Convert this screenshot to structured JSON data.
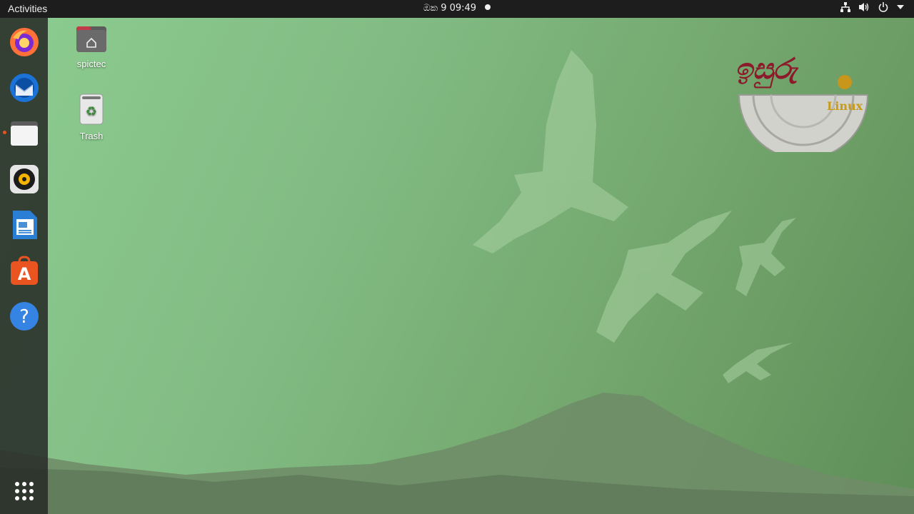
{
  "topbar": {
    "activities_label": "Activities",
    "clock_text": "ඔක 9  09:49",
    "tray_icons": [
      "network-icon",
      "volume-icon",
      "power-icon",
      "chevron-down-icon"
    ]
  },
  "dock": {
    "items": [
      {
        "name": "firefox",
        "icon": "firefox-icon",
        "running": false
      },
      {
        "name": "thunderbird",
        "icon": "thunderbird-icon",
        "running": false
      },
      {
        "name": "files",
        "icon": "files-icon",
        "running": true
      },
      {
        "name": "rhythmbox",
        "icon": "rhythmbox-icon",
        "running": false
      },
      {
        "name": "libreoffice-writer",
        "icon": "writer-icon",
        "running": false
      },
      {
        "name": "ubuntu-software",
        "icon": "software-icon",
        "running": false
      },
      {
        "name": "help",
        "icon": "help-icon",
        "running": false
      }
    ],
    "show_apps_icon": "app-grid-icon"
  },
  "desktop": {
    "home_label": "spictec",
    "trash_label": "Trash"
  },
  "logo": {
    "script_text": "ඉසුරු",
    "linux_text": "Linux"
  },
  "colors": {
    "topbar": "#1d1d1d",
    "dock": "#2c302c",
    "accent": "#e95420",
    "wallpaper_light": "#8ccc8f",
    "wallpaper_dark": "#5f8e58"
  }
}
